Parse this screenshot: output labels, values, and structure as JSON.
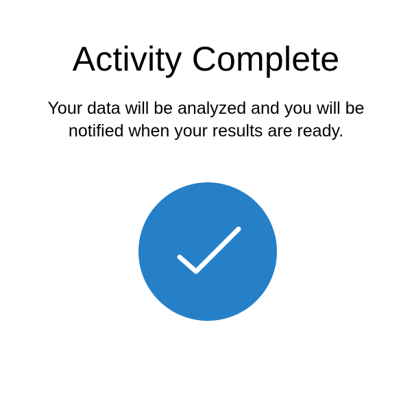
{
  "screen": {
    "title": "Activity Complete",
    "message": "Your data will be analyzed and you will be notified when your results are ready."
  },
  "status_icon": {
    "name": "checkmark-icon",
    "background_color": "#2680C8",
    "mark_color": "#FFFFFF"
  }
}
